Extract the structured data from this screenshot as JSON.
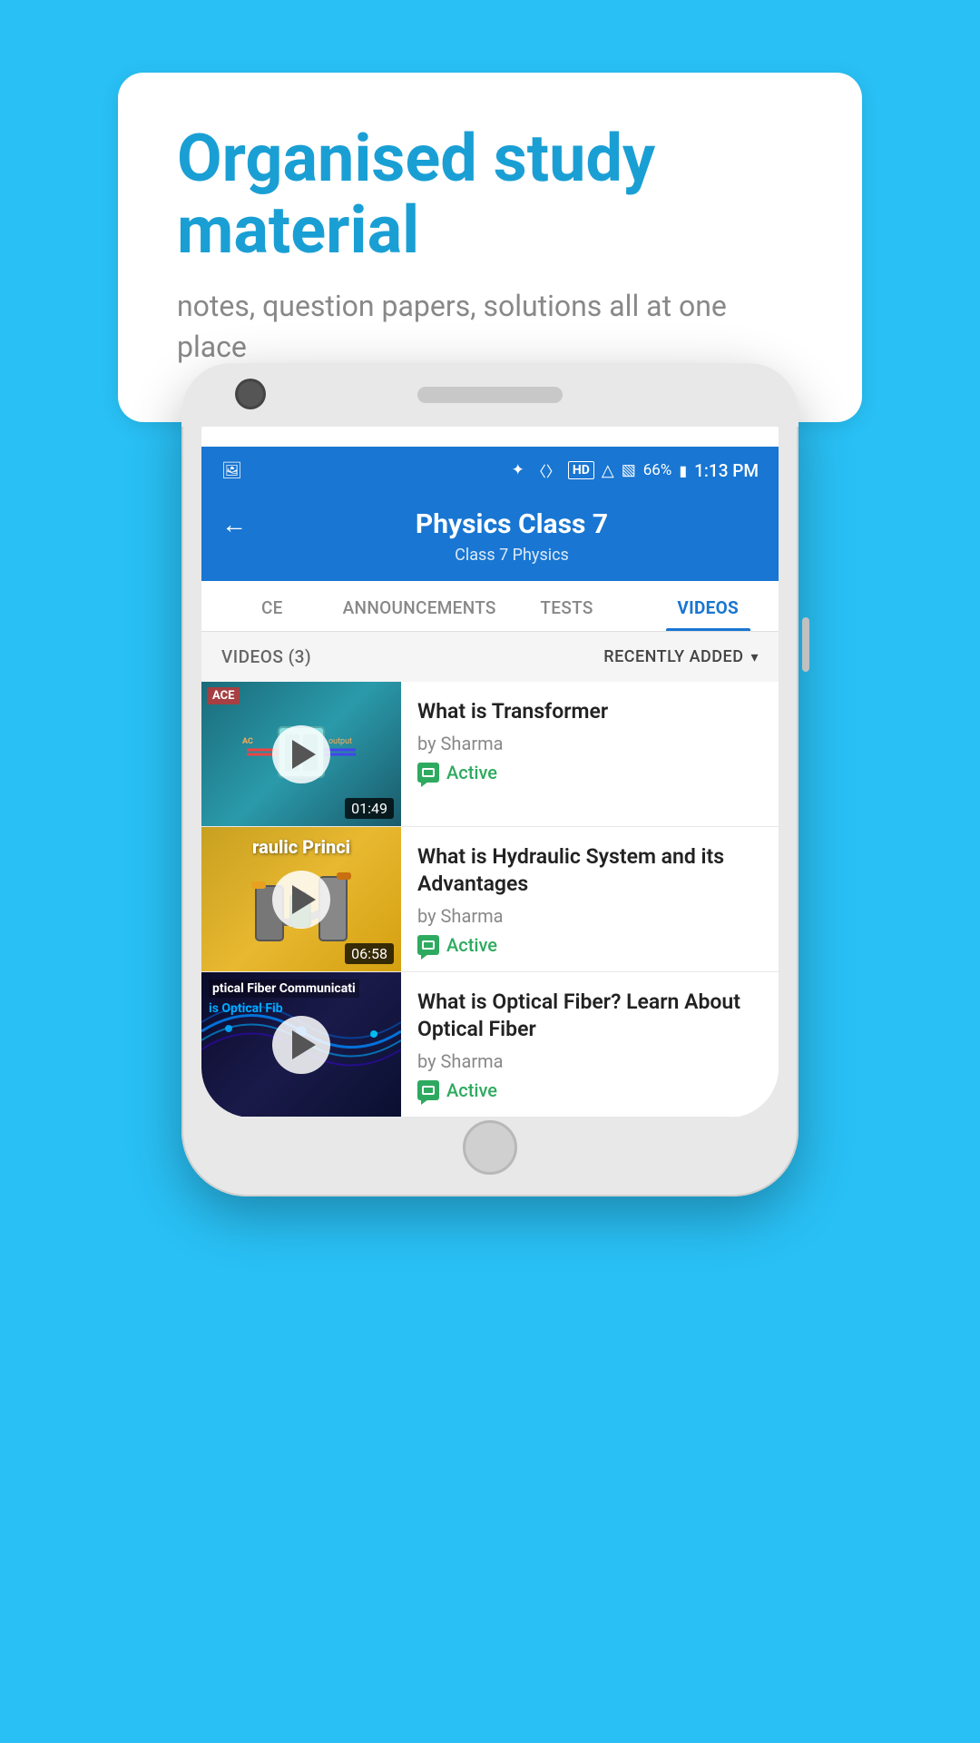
{
  "page": {
    "background_color": "#1ab8f0"
  },
  "speech_bubble": {
    "heading": "Organised study material",
    "subtext": "notes, question papers, solutions all at one place"
  },
  "phone": {
    "status_bar": {
      "time": "1:13 PM",
      "battery": "66%",
      "icons": [
        "bluetooth",
        "vibrate",
        "hd",
        "wifi",
        "signal",
        "battery"
      ]
    },
    "header": {
      "title": "Physics Class 7",
      "subtitle": "Class 7   Physics",
      "back_label": "←"
    },
    "tabs": [
      {
        "label": "CE",
        "active": false
      },
      {
        "label": "ANNOUNCEMENTS",
        "active": false
      },
      {
        "label": "TESTS",
        "active": false
      },
      {
        "label": "VIDEOS",
        "active": true
      }
    ],
    "filter_bar": {
      "count_label": "VIDEOS (3)",
      "sort_label": "RECENTLY ADDED",
      "sort_icon": "▾"
    },
    "videos": [
      {
        "title": "What is  Transformer",
        "author": "by Sharma",
        "status": "Active",
        "duration": "01:49",
        "thumbnail_type": "transformer",
        "thumbnail_label": "ACE"
      },
      {
        "title": "What is Hydraulic System and its Advantages",
        "author": "by Sharma",
        "status": "Active",
        "duration": "06:58",
        "thumbnail_type": "hydraulic",
        "thumbnail_text": "raulic Princi"
      },
      {
        "title": "What is Optical Fiber? Learn About Optical Fiber",
        "author": "by Sharma",
        "status": "Active",
        "duration": "",
        "thumbnail_type": "fiber",
        "thumbnail_text1": "ptical Fiber Communicati",
        "thumbnail_text2": "is Optical Fib"
      }
    ]
  }
}
